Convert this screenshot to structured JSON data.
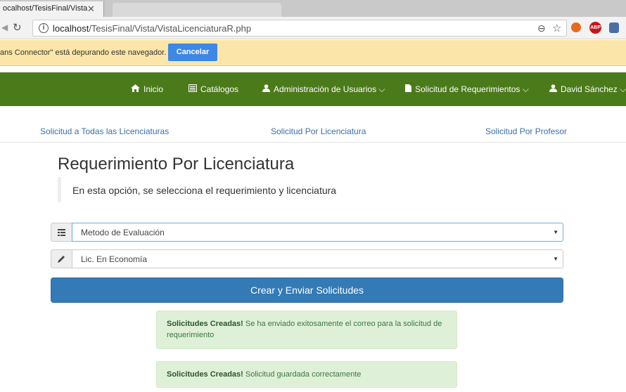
{
  "browser": {
    "tab_title": "ocalhost/TesisFinal/Vista",
    "tab_close": "✕",
    "url_host": "localhost",
    "url_path": "/TesisFinal/Vista/VistaLicenciaturaR.php",
    "debug_message": "ans Connector\" está depurando este navegador.",
    "debug_cancel": "Cancelar",
    "ext_abp": "ABP"
  },
  "navbar": {
    "items": [
      {
        "label": "Inicio"
      },
      {
        "label": "Catálogos"
      },
      {
        "label": "Administración de Usuarios"
      },
      {
        "label": "Solicitud de Requerimientos"
      },
      {
        "label": "David Sánchez"
      }
    ],
    "color": "#4b7a1a"
  },
  "subnav": {
    "links": [
      {
        "label": "Solicitud a Todas las Licenciaturas"
      },
      {
        "label": "Solicitud Por Licenciatura"
      },
      {
        "label": "Solicitud Por Profesor"
      }
    ]
  },
  "main": {
    "title": "Requerimiento Por Licenciatura",
    "description": "En esta opción, se selecciona el requerimiento y licenciatura",
    "requirement_select": {
      "value": "Metodo de Evaluación",
      "icon": "list-icon"
    },
    "degree_select": {
      "value": "Lic. En Economía",
      "icon": "pencil-icon"
    },
    "submit_label": "Crear y Enviar Solicitudes",
    "alerts": [
      {
        "title": "Solicitudes Creadas!",
        "message": "Se ha enviado exitosamente el correo para la solicitud de requerimiento"
      },
      {
        "title": "Solicitudes Creadas!",
        "message": "Solicitud guardada correctamente"
      }
    ]
  }
}
